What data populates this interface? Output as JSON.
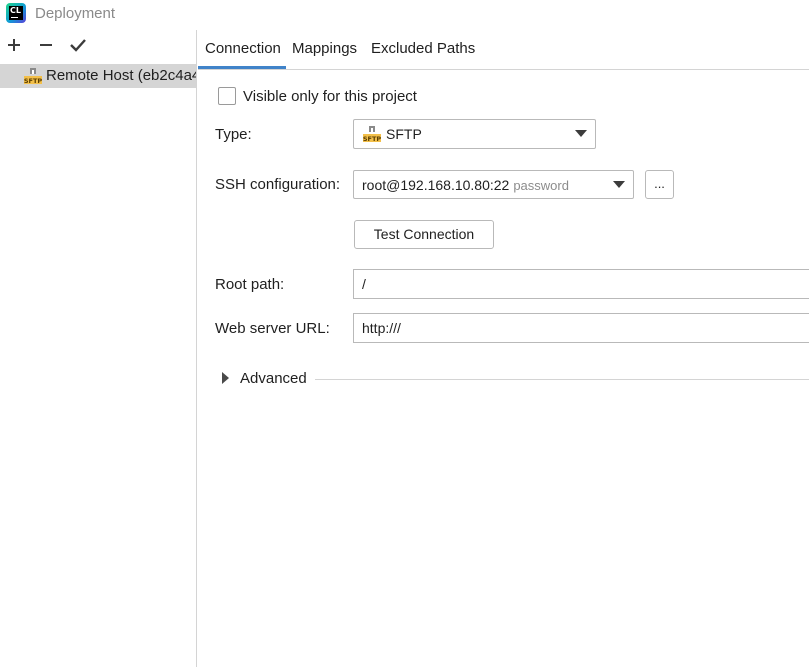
{
  "window": {
    "title": "Deployment",
    "logo_text": "CL"
  },
  "toolbar": {
    "add_icon": "plus-icon",
    "remove_icon": "minus-icon",
    "apply_icon": "check-icon"
  },
  "servers": [
    {
      "label": "Remote Host (eb2c4a4",
      "icon": "sftp-icon",
      "selected": true
    }
  ],
  "tabs": [
    {
      "label": "Connection",
      "active": true
    },
    {
      "label": "Mappings",
      "active": false
    },
    {
      "label": "Excluded Paths",
      "active": false
    }
  ],
  "form": {
    "visible_only_label": "Visible only for this project",
    "visible_only_checked": false,
    "type_label": "Type:",
    "type_value": "SFTP",
    "type_icon_text": "SFTP",
    "ssh_label": "SSH configuration:",
    "ssh_value": "root@192.168.10.80:22",
    "ssh_hint": "password",
    "browse_label": "...",
    "test_button_label": "Test Connection",
    "root_path_label": "Root path:",
    "root_path_value": "/",
    "web_url_label": "Web server URL:",
    "web_url_value": "http:///",
    "advanced_label": "Advanced"
  },
  "colors": {
    "accent": "#4083c9",
    "selected_row": "#d5d5d5",
    "sftp_badge": "#e8a21c"
  }
}
